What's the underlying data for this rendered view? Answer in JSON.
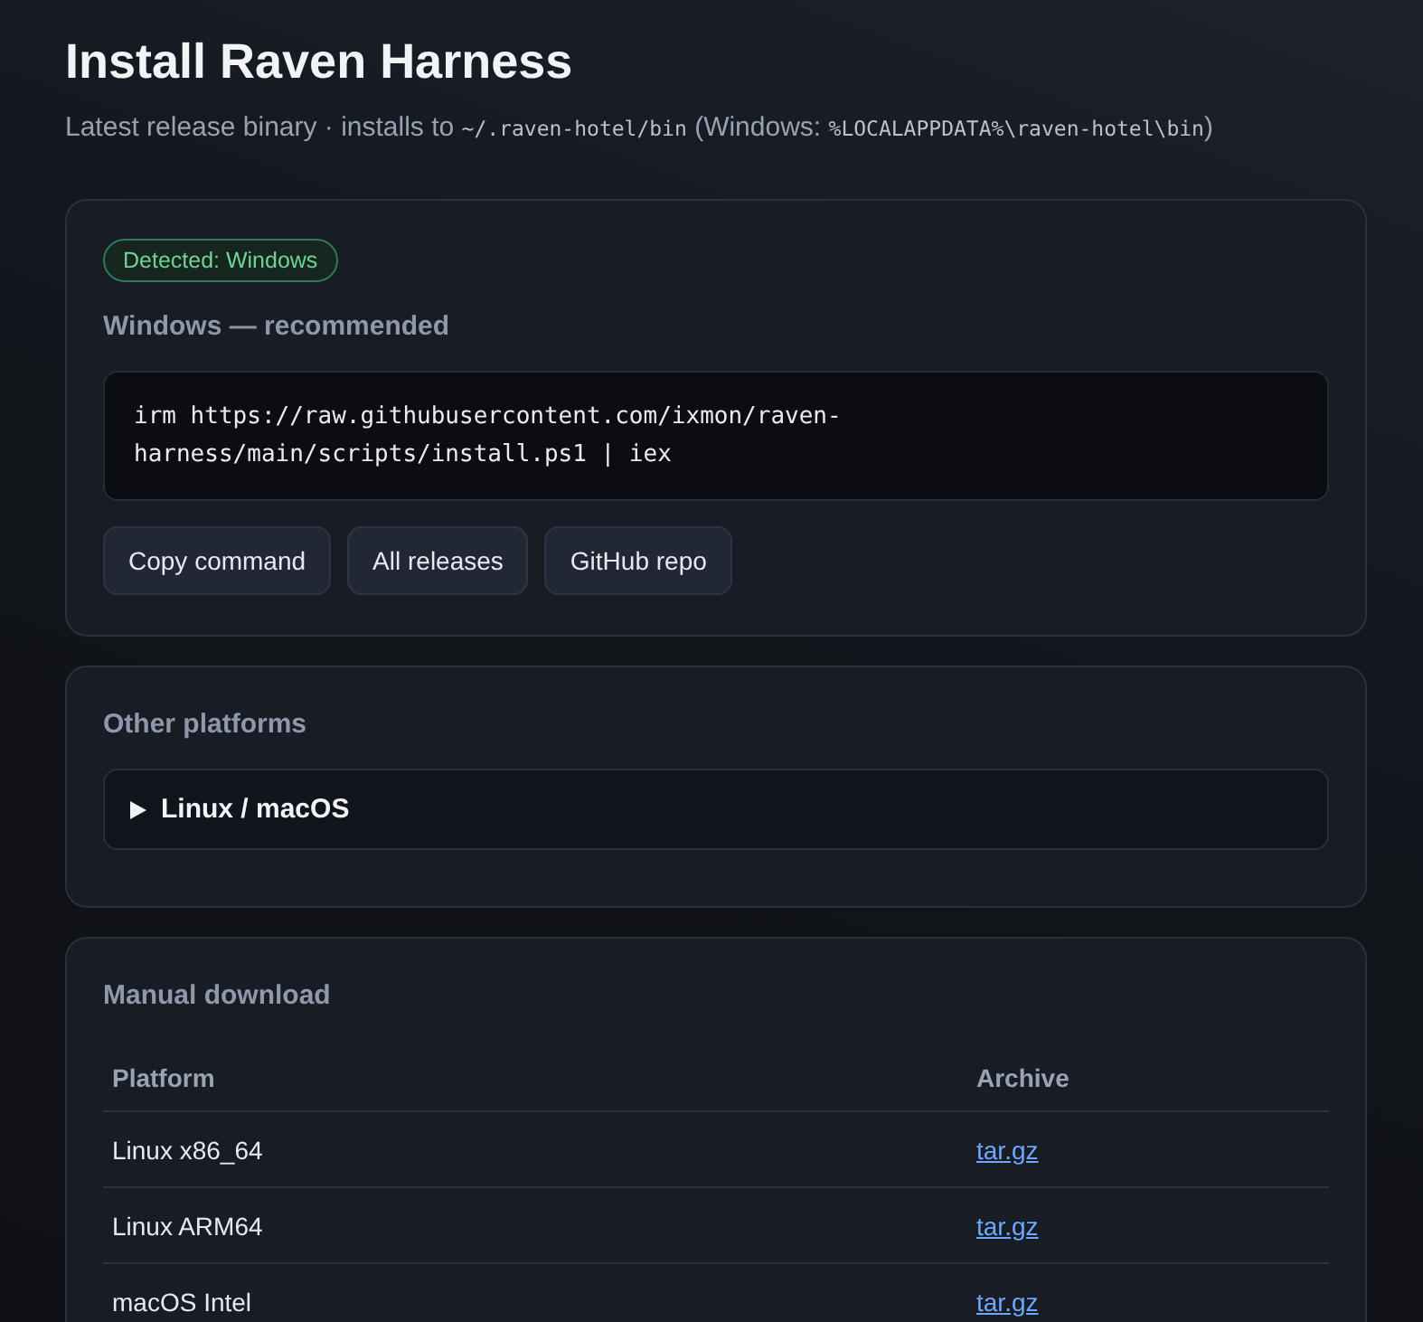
{
  "page": {
    "title": "Install Raven Harness",
    "subtitle": [
      {
        "kind": "text",
        "text": "Latest release binary · installs to "
      },
      {
        "kind": "code",
        "text": "~/.raven-hotel/bin"
      },
      {
        "kind": "text",
        "text": " (Windows: "
      },
      {
        "kind": "code",
        "text": "%LOCALAPPDATA%\\raven-hotel\\bin"
      },
      {
        "kind": "text",
        "text": ")"
      }
    ]
  },
  "install_card": {
    "badge": "Detected: Windows",
    "heading": "Windows — recommended",
    "command": "irm https://raw.githubusercontent.com/ixmon/raven-harness/main/scripts/install.ps1 | iex",
    "buttons": [
      "Copy command",
      "All releases",
      "GitHub repo"
    ]
  },
  "other_platforms": {
    "heading": "Other platforms",
    "sections": [
      {
        "label": "Linux / macOS",
        "expanded": false
      }
    ]
  },
  "manual_download": {
    "heading": "Manual download",
    "columns": [
      "Platform",
      "Archive"
    ],
    "rows": [
      {
        "platform": "Linux x86_64",
        "archive": "tar.gz"
      },
      {
        "platform": "Linux ARM64",
        "archive": "tar.gz"
      },
      {
        "platform": "macOS Intel",
        "archive": "tar.gz"
      }
    ]
  }
}
